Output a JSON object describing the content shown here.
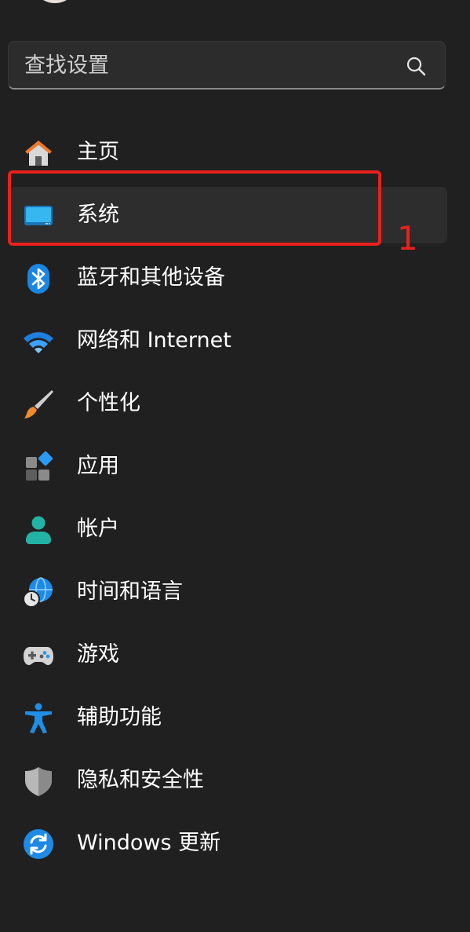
{
  "search": {
    "placeholder": "查找设置",
    "icon": "search-icon"
  },
  "nav": {
    "items": [
      {
        "key": "home",
        "label": "主页",
        "icon": "home-icon",
        "selected": false
      },
      {
        "key": "system",
        "label": "系统",
        "icon": "monitor-icon",
        "selected": true
      },
      {
        "key": "bluetooth",
        "label": "蓝牙和其他设备",
        "icon": "bluetooth-icon",
        "selected": false
      },
      {
        "key": "network",
        "label": "网络和 Internet",
        "icon": "wifi-icon",
        "selected": false
      },
      {
        "key": "personalization",
        "label": "个性化",
        "icon": "brush-icon",
        "selected": false
      },
      {
        "key": "apps",
        "label": "应用",
        "icon": "apps-icon",
        "selected": false
      },
      {
        "key": "accounts",
        "label": "帐户",
        "icon": "person-icon",
        "selected": false
      },
      {
        "key": "time-language",
        "label": "时间和语言",
        "icon": "globe-clock-icon",
        "selected": false
      },
      {
        "key": "gaming",
        "label": "游戏",
        "icon": "gamepad-icon",
        "selected": false
      },
      {
        "key": "accessibility",
        "label": "辅助功能",
        "icon": "accessibility-icon",
        "selected": false
      },
      {
        "key": "privacy",
        "label": "隐私和安全性",
        "icon": "shield-icon",
        "selected": false
      },
      {
        "key": "windows-update",
        "label": "Windows 更新",
        "icon": "update-icon",
        "selected": false
      }
    ]
  },
  "annotation": {
    "step": "1",
    "color": "#e8211d"
  },
  "colors": {
    "background": "#202020",
    "accent": "#4cc2ff",
    "selected_bg": "#2d2d2d"
  }
}
